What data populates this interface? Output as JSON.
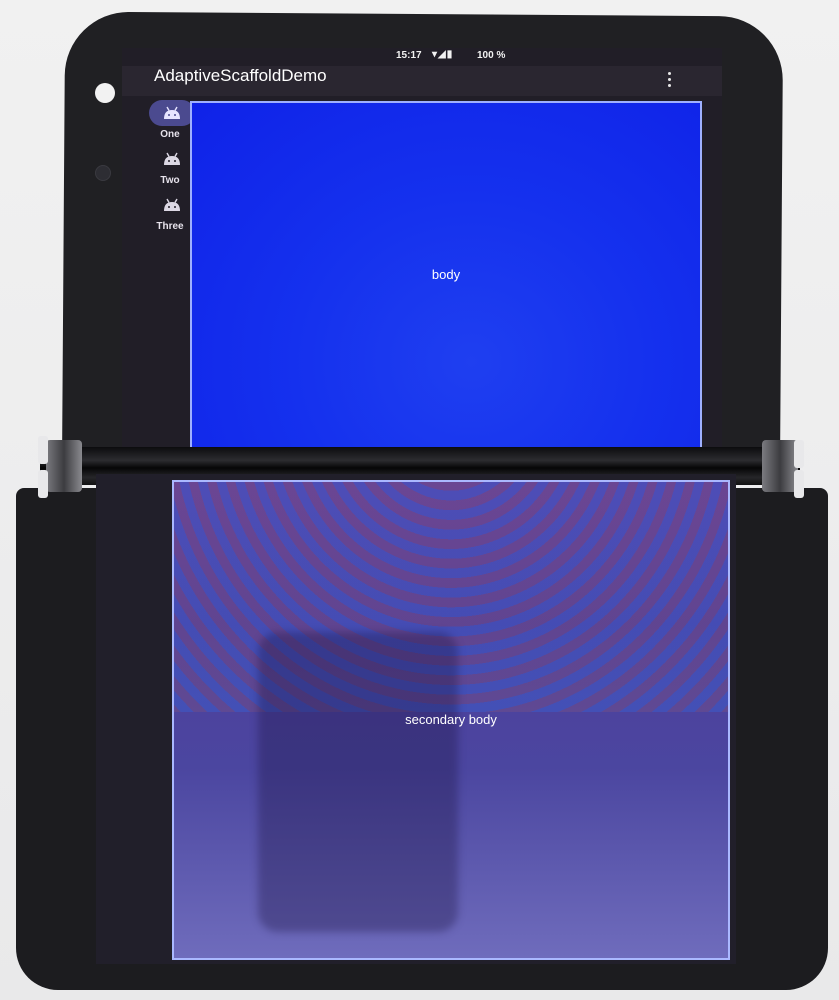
{
  "status_bar": {
    "time": "15:17",
    "icons": "▾◢▮",
    "battery": "100 %"
  },
  "app_bar": {
    "title": "AdaptiveScaffoldDemo",
    "overflow_icon": "more-vert-icon"
  },
  "nav_rail": {
    "items": [
      {
        "label": "One",
        "icon": "android-icon",
        "selected": true
      },
      {
        "label": "Two",
        "icon": "android-icon",
        "selected": false
      },
      {
        "label": "Three",
        "icon": "android-icon",
        "selected": false
      }
    ]
  },
  "body": {
    "label": "body",
    "color": "#1531ee"
  },
  "secondary_body": {
    "label": "secondary body",
    "color": "#4e3e9b"
  },
  "theme": {
    "rail_background": "#211e27",
    "selected_indicator": "#4b4a8f",
    "pane_border": "#9fb0ff"
  }
}
